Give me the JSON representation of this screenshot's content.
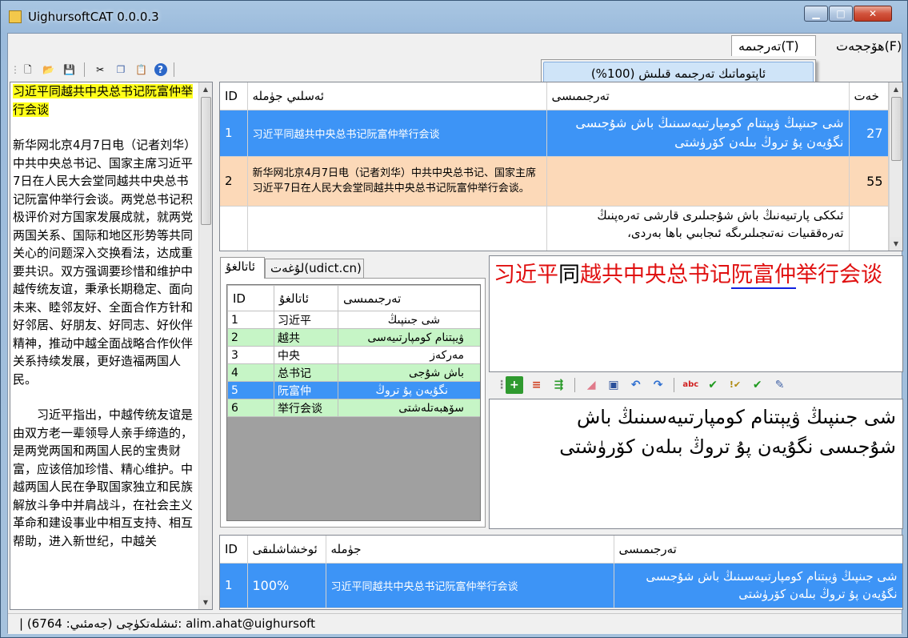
{
  "window": {
    "title": "UighursoftCAT 0.0.0.3",
    "min_glyph": "▁",
    "max_glyph": "□",
    "close_glyph": "✕"
  },
  "menu": {
    "items": [
      {
        "label": "ھۆججەت(F)"
      },
      {
        "label": "تەرجىمە(T)"
      }
    ],
    "dropdown_item": "ئاپتوماتىك تەرجىمە قىلىش (100%)"
  },
  "toolbar": {
    "icons": [
      "new-icon",
      "open-icon",
      "save-icon",
      "cut-icon",
      "copy-icon",
      "paste-icon",
      "help-icon"
    ]
  },
  "source": {
    "title_line": "习近平同越共中央总书记阮富仲举行会谈",
    "paragraph1": "新华网北京4月7日电（记者刘华）中共中央总书记、国家主席习近平7日在人民大会堂同越共中央总书记阮富仲举行会谈。两党总书记积极评价对方国家发展成就，就两党两国关系、国际和地区形势等共同关心的问题深入交换看法，达成重要共识。双方强调要珍惜和维护中越传统友谊，秉承长期稳定、面向未来、睦邻友好、全面合作方针和好邻居、好朋友、好同志、好伙伴精神，推动中越全面战略合作伙伴关系持续发展，更好造福两国人民。",
    "paragraph2": "习近平指出，中越传统友谊是由双方老一辈领导人亲手缔造的，是两党两国和两国人民的宝贵财富，应该倍加珍惜、精心维护。中越两国人民在争取国家独立和民族解放斗争中并肩战斗，在社会主义革命和建设事业中相互支持、相互帮助，进入新世纪，中越关"
  },
  "segments": {
    "headers": {
      "id": "ID",
      "source": "ئەسلىي جۈملە",
      "target": "تەرجىمىسى",
      "chars": "خەت"
    },
    "rows": [
      {
        "id": "1",
        "source": "习近平同越共中央总书记阮富仲举行会谈",
        "target": "شى جىنپىڭ ۋيېتنام كومپارتىيەسىنىڭ باش شۇجىسى نگۇيەن پۇ تروڭ بىلەن كۆرۈشتى",
        "chars": "27"
      },
      {
        "id": "2",
        "source": "新华网北京4月7日电（记者刘华）中共中央总书记、国家主席习近平7日在人民大会堂同越共中央总书记阮富仲举行会谈。",
        "target": "",
        "chars": "55"
      },
      {
        "id": "",
        "source": "",
        "target": "ئىككى پارتىيەنىڭ باش شۇجىلىرى قارشى تەرەپنىڭ تەرەققىيات نەتىجىلىرىگە ئىجابىي باھا بەردى،",
        "chars": ""
      }
    ]
  },
  "term_tabs": [
    {
      "label": "ئاتالغۇ"
    },
    {
      "label": "لۇغەت(udict.cn)"
    }
  ],
  "terms": {
    "headers": {
      "id": "ID",
      "term": "ئاتالغۇ",
      "translation": "تەرجىمىسى"
    },
    "rows": [
      {
        "id": "1",
        "term": "习近平",
        "translation": "شى جىنپىڭ"
      },
      {
        "id": "2",
        "term": "越共",
        "translation": "ۋيېتنام كومپارتىيەسى"
      },
      {
        "id": "3",
        "term": "中央",
        "translation": "مەركەز"
      },
      {
        "id": "4",
        "term": "总书记",
        "translation": "باش شۇجى"
      },
      {
        "id": "5",
        "term": "阮富仲",
        "translation": "نگۇيەن پۇ تروڭ"
      },
      {
        "id": "6",
        "term": "举行会谈",
        "translation": "سۆھبەتلەشتى"
      }
    ]
  },
  "preview": {
    "p1": "习近平",
    "p2": "同",
    "p3": "越共中央总书记",
    "p4": "阮富仲",
    "p5": "举行会谈"
  },
  "edit_toolbar": {
    "icons": [
      "add-icon",
      "insert-icon",
      "copy-source-icon",
      "erase-icon",
      "save-icon",
      "undo-icon",
      "redo-icon",
      "spellcheck-icon",
      "check-icon",
      "check-all-icon",
      "confirm-icon",
      "edit-doc-icon",
      "download-icon"
    ]
  },
  "editor": {
    "text": "شى جىنپىڭ ۋيېتنام كومپارتىيەسىنىڭ باش شۇجىسى نگۇيەن پۇ تروڭ بىلەن كۆرۈشتى"
  },
  "matches": {
    "headers": {
      "id": "ID",
      "similarity": "ئوخشاشلىقى",
      "sentence": "جۈملە",
      "translation": "تەرجىمىسى"
    },
    "rows": [
      {
        "id": "1",
        "similarity": "100%",
        "sentence": "习近平同越共中央总书记阮富仲举行会谈",
        "translation": "شى جىنپىڭ ۋيېتنام كومپارتىيەسىنىڭ باش شۇجىسى نگۇيەن پۇ تروڭ بىلەن كۆرۈشتى"
      }
    ]
  },
  "status": {
    "text": "| (6764 :جەمئىي) ئىشلەتكۈچى: alim.ahat@uighursoft"
  },
  "colors": {
    "selection": "#3d94f6",
    "peach": "#fcd9b8",
    "term_green": "#c6f5c6",
    "highlight": "#ffff1a",
    "preview_red": "#e01010"
  }
}
